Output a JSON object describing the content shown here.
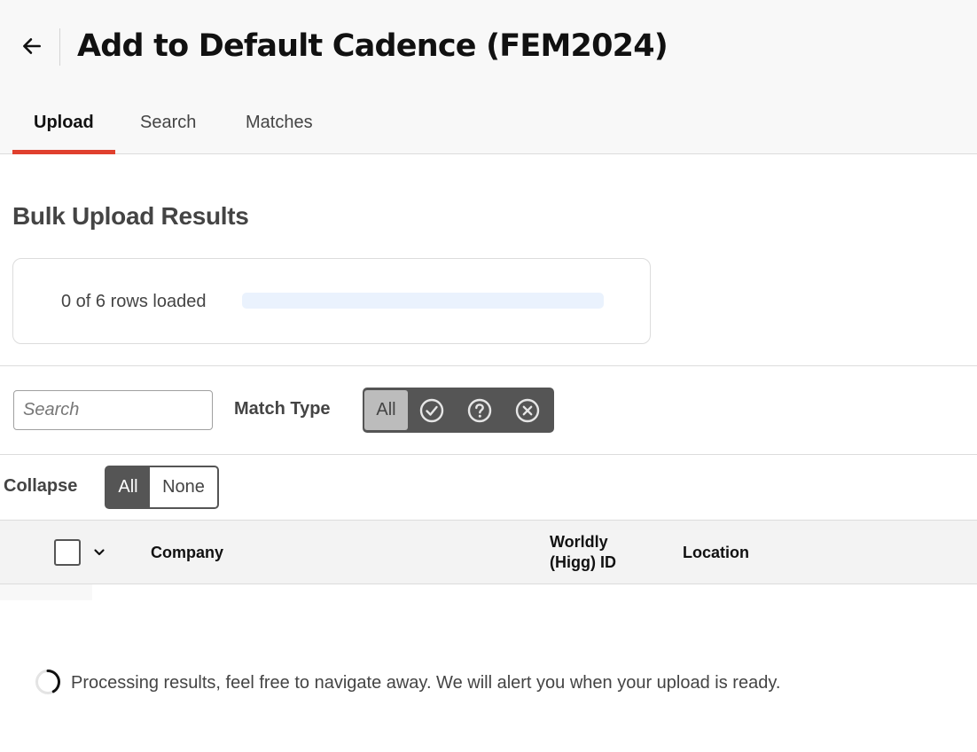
{
  "header": {
    "title": "Add to Default Cadence (FEM2024)",
    "back_icon": "arrow-left-icon"
  },
  "tabs": [
    {
      "label": "Upload",
      "active": true
    },
    {
      "label": "Search",
      "active": false
    },
    {
      "label": "Matches",
      "active": false
    }
  ],
  "accent_color": "#e0402e",
  "section": {
    "title": "Bulk Upload Results"
  },
  "progress": {
    "label": "0 of 6 rows loaded",
    "loaded": 0,
    "total": 6,
    "fraction": 0
  },
  "filters": {
    "search_placeholder": "Search",
    "match_type_label": "Match Type",
    "match_all_label": "All",
    "match_icons": [
      "check-circle-icon",
      "question-circle-icon",
      "x-circle-icon"
    ]
  },
  "collapse": {
    "label": "Collapse",
    "all_label": "All",
    "none_label": "None",
    "selected": "None"
  },
  "table": {
    "columns": {
      "company": "Company",
      "worldly_id_line1": "Worldly",
      "worldly_id_line2": "(Higg) ID",
      "location": "Location"
    }
  },
  "status": {
    "message": "Processing results, feel free to navigate away. We will alert you when your upload is ready."
  }
}
